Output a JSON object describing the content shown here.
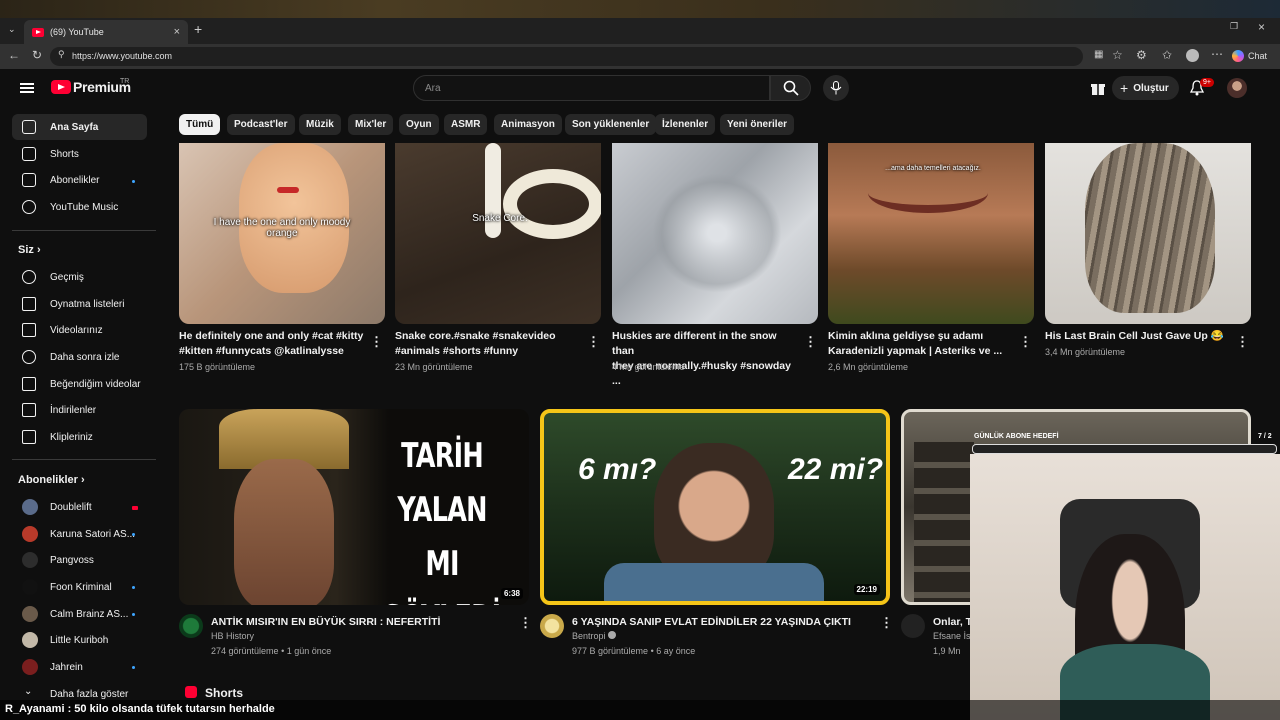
{
  "browser": {
    "tab_title": "(69) YouTube",
    "url": "https://www.youtube.com",
    "chat_label": "Chat"
  },
  "header": {
    "brand": "Premium",
    "country": "TR",
    "search_placeholder": "Ara",
    "create_label": "Oluştur",
    "notif_badge": "9+"
  },
  "chips": [
    "Tümü",
    "Podcast'ler",
    "Müzik",
    "Mix'ler",
    "Oyun",
    "ASMR",
    "Animasyon",
    "Son yüklenenler",
    "İzlenenler",
    "Yeni öneriler"
  ],
  "sidebar": {
    "main": [
      "Ana Sayfa",
      "Shorts",
      "Abonelikler",
      "YouTube Music"
    ],
    "you_heading": "Siz",
    "you": [
      "Geçmiş",
      "Oynatma listeleri",
      "Videolarınız",
      "Daha sonra izle",
      "Beğendiğim videolar",
      "İndirilenler",
      "Klipleriniz"
    ],
    "subs_heading": "Abonelikler",
    "subs": [
      "Doublelift",
      "Karuna Satori AS...",
      "Pangvoss",
      "Foon Kriminal",
      "Calm Brainz AS...",
      "Little Kuriboh",
      "Jahrein"
    ],
    "more": "Daha fazla göster"
  },
  "shorts": [
    {
      "caption": "I have the one and only moody orange",
      "title1": "He definitely one and only #cat #kitty",
      "title2": "#kitten #funnycats @katlinalysse",
      "views": "175 B görüntüleme"
    },
    {
      "caption": "Snake Core.",
      "title1": "Snake core.#snake #snakevideo",
      "title2": "#animals #shorts #funny",
      "views": "23 Mn görüntüleme"
    },
    {
      "caption": "",
      "title1": "Huskies are different in the snow than",
      "title2": "they are normally.#husky #snowday ...",
      "views": "4 Mn görüntüleme"
    },
    {
      "caption": "...ama daha temelleri atacağız.",
      "title1": "Kimin aklına geldiyse şu adamı",
      "title2": "Karadenizli yapmak | Asteriks ve ...",
      "views": "2,6 Mn görüntüleme"
    },
    {
      "caption": "",
      "title1": "His Last Brain Cell Just Gave Up 😂",
      "title2": "",
      "views": "3,4 Mn görüntüleme"
    }
  ],
  "videos": [
    {
      "thumb_lines": [
        "TARİH",
        "YALAN MI",
        "SÖYLEDİ"
      ],
      "duration": "6:38",
      "title": "ANTİK MISIR'IN EN BÜYÜK SIRRI : NEFERTİTİ",
      "channel": "HB History",
      "views": "274 görüntüleme",
      "age": "1 gün önce"
    },
    {
      "thumb_left": "6 mı?",
      "thumb_right": "22 mi?",
      "duration": "22:19",
      "title": "6 YAŞINDA SANIP EVLAT EDİNDİLER 22 YAŞINDA ÇIKTI",
      "channel": "Bentropi",
      "views": "977 B görüntüleme",
      "age": "6 ay önce"
    },
    {
      "title": "Onlar, T",
      "channel": "Efsane İs",
      "views": "1,9 Mn"
    }
  ],
  "shorts_heading": "Shorts",
  "overlay": {
    "goal_label": "GÜNLÜK ABONE HEDEFİ",
    "goal_count": "7 / 2",
    "chat_user": "R_Ayanami",
    "chat_message": ": 50 kilo olsanda tüfek tutarsın herhalde"
  },
  "colors": {
    "brand": "#ff0033",
    "highlight": "#f5c518",
    "accent": "#3ea6ff"
  }
}
